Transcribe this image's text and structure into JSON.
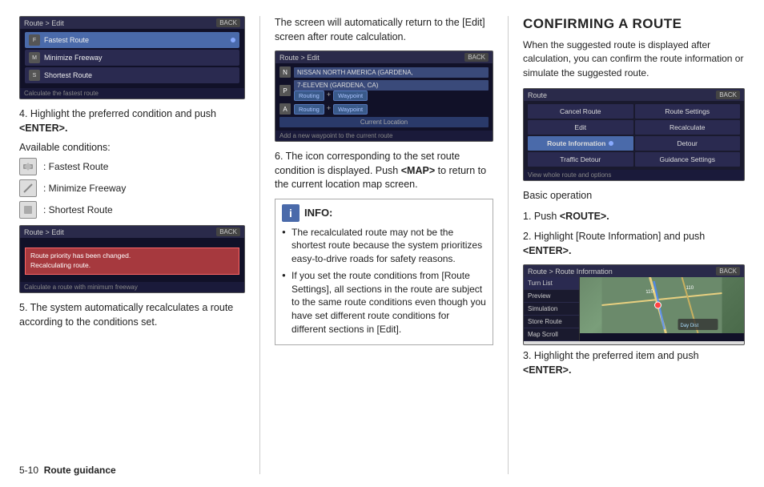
{
  "page": {
    "footer": {
      "page_num": "5-10",
      "section": "Route guidance"
    }
  },
  "left": {
    "screen1": {
      "titlebar": "Route > Edit",
      "back": "BACK",
      "items": [
        {
          "label": "Fastest Route",
          "selected": true,
          "icon": "F"
        },
        {
          "label": "Minimize Freeway",
          "selected": false,
          "icon": "M"
        },
        {
          "label": "Shortest Route",
          "selected": false,
          "icon": "S"
        }
      ],
      "footer": "Calculate the fastest route"
    },
    "step4_text": "4.  Highlight the preferred condition and push",
    "step4_bold": "<ENTER>.",
    "conditions_label": "Available conditions:",
    "conditions": [
      {
        "icon": "F",
        "label": ": Fastest Route"
      },
      {
        "icon": "M",
        "label": ": Minimize Freeway"
      },
      {
        "icon": "S",
        "label": ": Shortest Route"
      }
    ],
    "screen2": {
      "titlebar": "Route > Edit",
      "back": "BACK",
      "recalc_text": "Route priority has been changed.\nRecalculating route.",
      "footer": "Calculate a route with minimum freeway"
    },
    "step5_text": "5.  The system automatically recalculates a route according to the conditions set."
  },
  "middle": {
    "intro_text": "The screen will automatically return to the [Edit] screen after route calculation.",
    "screen3": {
      "titlebar": "Route > Edit",
      "back": "BACK",
      "dest_name": "NISSAN NORTH AMERICA (GARDENA,",
      "row1": {
        "letter": "P",
        "name": "7-ELEVEN (GARDENA, CA)",
        "routing": "Routing",
        "plus": "+",
        "waypoint": "Waypoint"
      },
      "row2": {
        "routing": "Routing",
        "plus": "+",
        "waypoint": "Waypoint"
      },
      "current": "Current Location",
      "footer": "Add a new waypoint to the current route"
    },
    "step6_text": "6.  The icon corresponding to the set route condition is displayed. Push",
    "step6_map": "<MAP>",
    "step6_text2": "to return to the current location map screen.",
    "info": {
      "title": "INFO:",
      "bullets": [
        "The recalculated route may not be the shortest route because the system prioritizes easy-to-drive roads for safety reasons.",
        "If you set the route conditions from [Route Settings], all sections in the route are subject to the same route conditions even though you have set different route conditions for different sections in [Edit]."
      ]
    }
  },
  "right": {
    "section_title": "CONFIRMING A ROUTE",
    "intro": "When the suggested route is displayed after calculation, you can confirm the route information or simulate the suggested route.",
    "screen4": {
      "titlebar": "Route",
      "back": "BACK",
      "cells": [
        {
          "label": "Cancel Route",
          "highlight": false
        },
        {
          "label": "Route Settings",
          "highlight": false
        },
        {
          "label": "Edit",
          "highlight": false
        },
        {
          "label": "Recalculate",
          "highlight": false
        },
        {
          "label": "Route Information",
          "highlight": true,
          "dot": true
        },
        {
          "label": "Detour",
          "highlight": false
        },
        {
          "label": "Traffic Detour",
          "highlight": false
        },
        {
          "label": "Guidance Settings",
          "highlight": false
        }
      ],
      "footer": "View whole route and options"
    },
    "basic_op": "Basic operation",
    "step1": "1.  Push",
    "step1_bold": "<ROUTE>.",
    "step2": "2.  Highlight [Route Information] and push",
    "step2_bold": "<ENTER>.",
    "screen5": {
      "titlebar": "Route > Route Information",
      "back": "BACK",
      "items": [
        {
          "label": "Turn List"
        },
        {
          "label": "Preview"
        },
        {
          "label": "Simulation"
        },
        {
          "label": "Store Route"
        },
        {
          "label": "Map Scroll"
        }
      ]
    },
    "step3": "3.  Highlight the preferred item and push",
    "step3_bold": "<ENTER>."
  }
}
